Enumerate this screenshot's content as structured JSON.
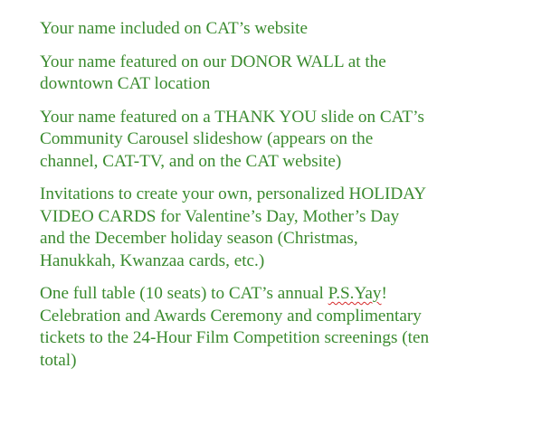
{
  "colors": {
    "text": "#3a8a2e",
    "spellcheck_underline": "#d62b2b"
  },
  "benefits": {
    "item1": "Your name included on CAT’s website",
    "item2": "Your name featured on our DONOR WALL at the\ndowntown CAT location",
    "item3": "Your name featured on a THANK YOU slide on CAT’s\nCommunity Carousel slideshow (appears on the\nchannel, CAT-TV, and on the CAT website)",
    "item4": "Invitations to create your own, personalized HOLIDAY\nVIDEO CARDS for Valentine’s Day, Mother’s Day\nand the December holiday season (Christmas,\nHanukkah, Kwanzaa cards, etc.)",
    "item5_prefix": "One full table (10 seats) to CAT’s annual ",
    "item5_event": "P.S.Yay",
    "item5_suffix": "!\nCelebration and Awards Ceremony and complimentary\ntickets to the 24-Hour Film Competition screenings (ten\ntotal)"
  }
}
